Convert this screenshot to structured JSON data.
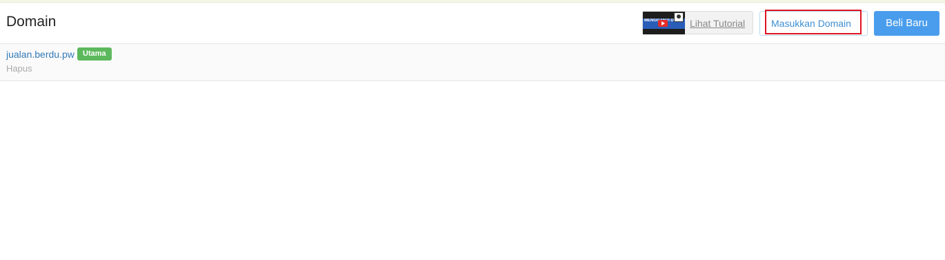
{
  "header": {
    "title": "Domain",
    "tutorial": {
      "thumbnail_text": "MENGGANTI DOMAIN TAMU",
      "label": "Lihat Tutorial"
    },
    "enter_domain_label": "Masukkan Domain",
    "buy_new_label": "Beli Baru"
  },
  "domains": [
    {
      "name": "jualan.berdu.pw",
      "badge": "Utama",
      "delete_label": "Hapus"
    }
  ],
  "colors": {
    "link": "#337ab7",
    "badge_primary": "#5cb85c",
    "buy_button": "#4a9ded",
    "highlight": "#e0121f"
  }
}
